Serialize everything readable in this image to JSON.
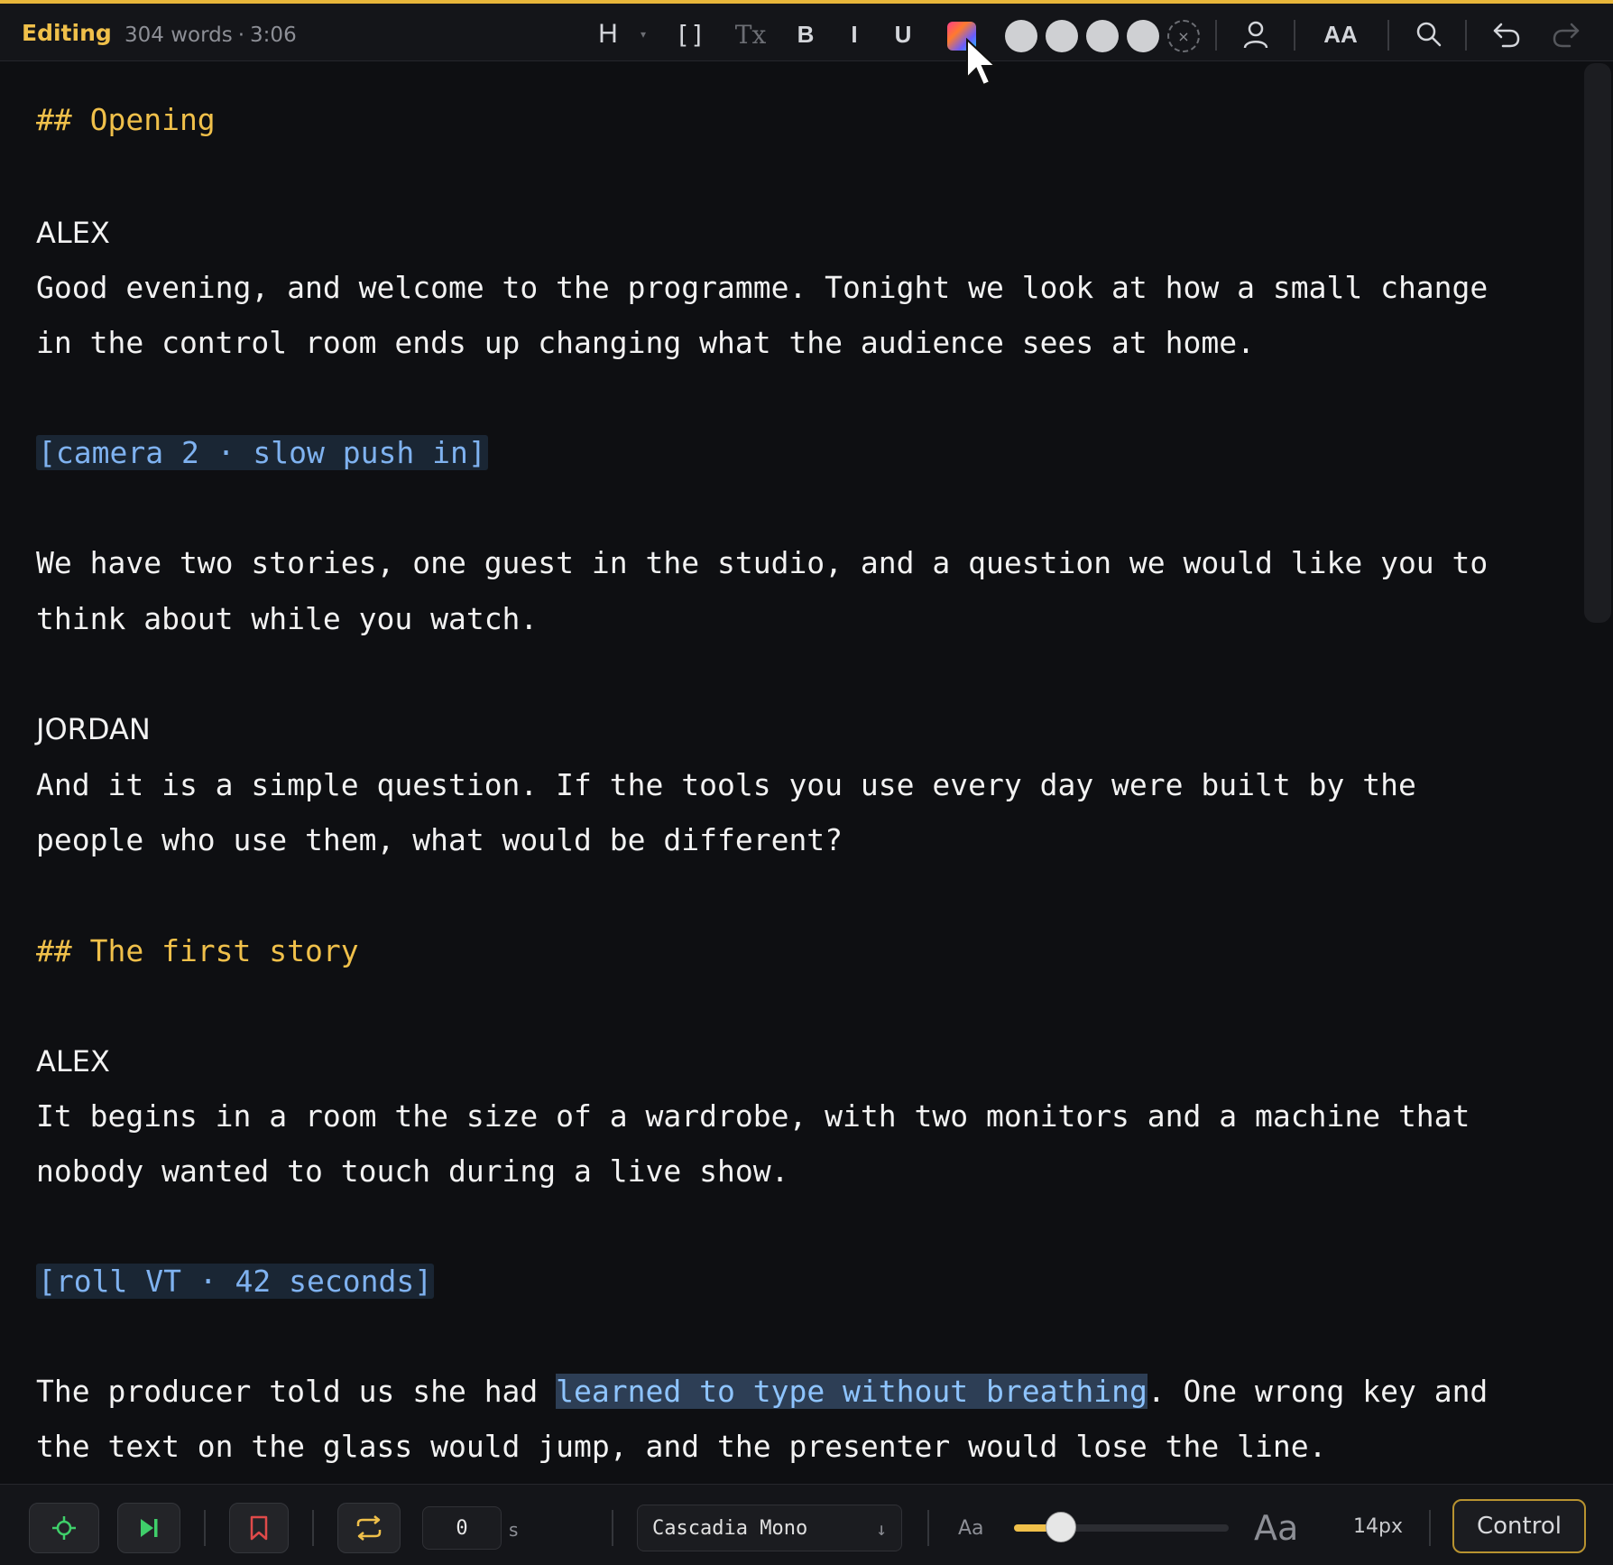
{
  "header": {
    "mode": "Editing",
    "word_count": "304 words",
    "separator": "·",
    "duration": "3:06"
  },
  "toolbar": {
    "heading": "H",
    "brackets": "[]",
    "clear_format": "Tx",
    "bold": "B",
    "italic": "I",
    "underline": "U",
    "font_size_toggle": "AA",
    "icons": [
      "heading-icon",
      "bracket-icon",
      "clear-format-icon",
      "color-picker-icon",
      "person-icon",
      "search-icon",
      "undo-icon",
      "redo-icon"
    ]
  },
  "script": {
    "h1": "## Opening",
    "speaker1": "ALEX",
    "p1a": "Good evening, and welcome to the programme. Tonight we look at how a small change",
    "p1b": "in the control room ends up changing what the audience sees at home.",
    "cue1": "[camera 2 · slow push in]",
    "p2a": "We have two stories, one guest in the studio, and a question we would like you to",
    "p2b": "think about while you watch.",
    "speaker2": "JORDAN",
    "p3a": "And it is a simple question. If the tools you use every day were built by the",
    "p3b": "people who use them, what would be different?",
    "h2": "## The first story",
    "speaker3": "ALEX",
    "p4a": "It begins in a room the size of a wardrobe, with two monitors and a machine that",
    "p4b": "nobody wanted to touch during a live show.",
    "cue2": "[roll VT · 42 seconds]",
    "p5a_pre": "The producer told us she had ",
    "p5a_hl": "learned to type without breathing",
    "p5a_post": ". One wrong key and",
    "p5b": "the text on the glass would jump, and the presenter would lose the line."
  },
  "bottom": {
    "countdown_value": "0",
    "countdown_unit": "s",
    "font": "Cascadia Mono",
    "font_arrow": "↓",
    "size_small": "Aa",
    "size_large": "Aa",
    "size_value": "14px",
    "size_slider_fraction": 0.22,
    "control_label": "Control"
  },
  "colors": {
    "accent": "#f0c04a",
    "cue": "#7fb2f0",
    "highlight": "#2d3e55",
    "background": "#0e0f12"
  }
}
